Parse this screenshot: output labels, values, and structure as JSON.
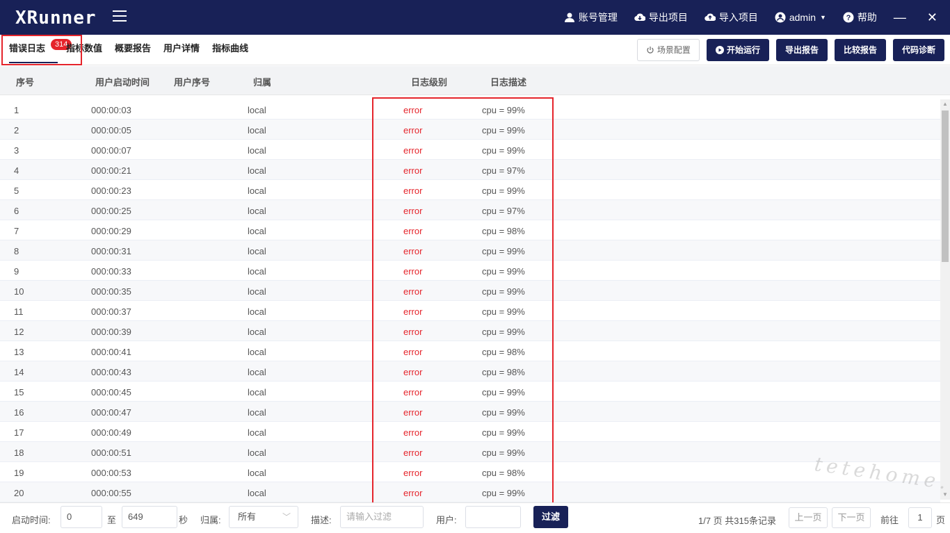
{
  "app": {
    "logo": "XRunner",
    "header_actions": [
      {
        "label": "账号管理",
        "icon": "user-icon"
      },
      {
        "label": "导出项目",
        "icon": "cloud-download-icon"
      },
      {
        "label": "导入项目",
        "icon": "cloud-upload-icon"
      },
      {
        "label": "admin",
        "icon": "account-circle-icon"
      },
      {
        "label": "帮助",
        "icon": "help-icon"
      }
    ],
    "minimize_glyph": "—",
    "close_glyph": "✕"
  },
  "tabs": [
    {
      "label": "错误日志",
      "badge": "314",
      "active": true
    },
    {
      "label": "指标数值"
    },
    {
      "label": "概要报告"
    },
    {
      "label": "用户详情"
    },
    {
      "label": "指标曲线"
    }
  ],
  "toolbar": {
    "scene_config": "场景配置",
    "start_run": "开始运行",
    "export_report": "导出报告",
    "compare_report": "比较报告",
    "code_diagnose": "代码诊断"
  },
  "table": {
    "headers": {
      "index": "序号",
      "start_time": "用户启动时间",
      "user_index": "用户序号",
      "owner": "归属",
      "level": "日志级别",
      "description": "日志描述"
    },
    "rows": [
      {
        "index": "1",
        "time": "000:00:03",
        "owner": "local",
        "level": "error",
        "desc": "cpu = 99%"
      },
      {
        "index": "2",
        "time": "000:00:05",
        "owner": "local",
        "level": "error",
        "desc": "cpu = 99%"
      },
      {
        "index": "3",
        "time": "000:00:07",
        "owner": "local",
        "level": "error",
        "desc": "cpu = 99%"
      },
      {
        "index": "4",
        "time": "000:00:21",
        "owner": "local",
        "level": "error",
        "desc": "cpu = 97%"
      },
      {
        "index": "5",
        "time": "000:00:23",
        "owner": "local",
        "level": "error",
        "desc": "cpu = 99%"
      },
      {
        "index": "6",
        "time": "000:00:25",
        "owner": "local",
        "level": "error",
        "desc": "cpu = 97%"
      },
      {
        "index": "7",
        "time": "000:00:29",
        "owner": "local",
        "level": "error",
        "desc": "cpu = 98%"
      },
      {
        "index": "8",
        "time": "000:00:31",
        "owner": "local",
        "level": "error",
        "desc": "cpu = 99%"
      },
      {
        "index": "9",
        "time": "000:00:33",
        "owner": "local",
        "level": "error",
        "desc": "cpu = 99%"
      },
      {
        "index": "10",
        "time": "000:00:35",
        "owner": "local",
        "level": "error",
        "desc": "cpu = 99%"
      },
      {
        "index": "11",
        "time": "000:00:37",
        "owner": "local",
        "level": "error",
        "desc": "cpu = 99%"
      },
      {
        "index": "12",
        "time": "000:00:39",
        "owner": "local",
        "level": "error",
        "desc": "cpu = 99%"
      },
      {
        "index": "13",
        "time": "000:00:41",
        "owner": "local",
        "level": "error",
        "desc": "cpu = 98%"
      },
      {
        "index": "14",
        "time": "000:00:43",
        "owner": "local",
        "level": "error",
        "desc": "cpu = 98%"
      },
      {
        "index": "15",
        "time": "000:00:45",
        "owner": "local",
        "level": "error",
        "desc": "cpu = 99%"
      },
      {
        "index": "16",
        "time": "000:00:47",
        "owner": "local",
        "level": "error",
        "desc": "cpu = 99%"
      },
      {
        "index": "17",
        "time": "000:00:49",
        "owner": "local",
        "level": "error",
        "desc": "cpu = 99%"
      },
      {
        "index": "18",
        "time": "000:00:51",
        "owner": "local",
        "level": "error",
        "desc": "cpu = 99%"
      },
      {
        "index": "19",
        "time": "000:00:53",
        "owner": "local",
        "level": "error",
        "desc": "cpu = 98%"
      },
      {
        "index": "20",
        "time": "000:00:55",
        "owner": "local",
        "level": "error",
        "desc": "cpu = 99%"
      }
    ]
  },
  "filters": {
    "start_time_label": "启动时间:",
    "start_from": "0",
    "to_label": "至",
    "start_to": "649",
    "seconds_label": "秒",
    "owner_label": "归属:",
    "owner_value": "所有",
    "desc_label": "描述:",
    "desc_placeholder": "请输入过滤",
    "user_label": "用户:",
    "user_value": "",
    "filter_button": "过滤"
  },
  "pagination": {
    "page_info": "1/7 页 共315条记录",
    "prev": "上一页",
    "next": "下一页",
    "goto_label": "前往",
    "goto_value": "1",
    "page_suffix": "页"
  },
  "watermark": "tetehome.com",
  "colors": {
    "brand": "#182157",
    "error": "#e5242b",
    "highlight": "#e5242b"
  }
}
